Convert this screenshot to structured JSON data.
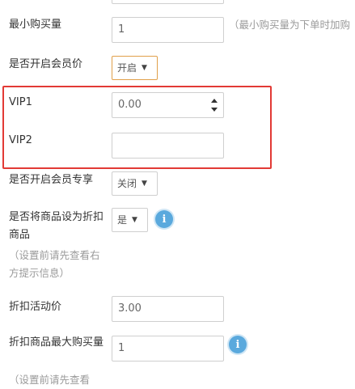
{
  "form": {
    "min_buy": {
      "label": "最小购买量",
      "value": "1",
      "hint": "（最小购买量为下单时加购"
    },
    "member_price_enable": {
      "label": "是否开启会员价",
      "value": "开启"
    },
    "vip1": {
      "label": "VIP1",
      "value": "0.00"
    },
    "vip2": {
      "label": "VIP2",
      "value": ""
    },
    "member_exclusive": {
      "label": "是否开启会员专享",
      "value": "关闭"
    },
    "set_discount": {
      "label": "是否将商品设为折扣商品",
      "value": "是",
      "hint": "（设置前请先查看右方提示信息）"
    },
    "discount_price": {
      "label": "折扣活动价",
      "value": "3.00"
    },
    "discount_max_buy": {
      "label": "折扣商品最大购买量",
      "value": "1",
      "hint": "（设置前请先查看"
    }
  },
  "icons": {
    "info": "i",
    "caret": "▼"
  },
  "colors": {
    "highlight_border": "#e23a35",
    "active_select_border": "#e1a04a",
    "info_icon": "#5aa9dd"
  }
}
